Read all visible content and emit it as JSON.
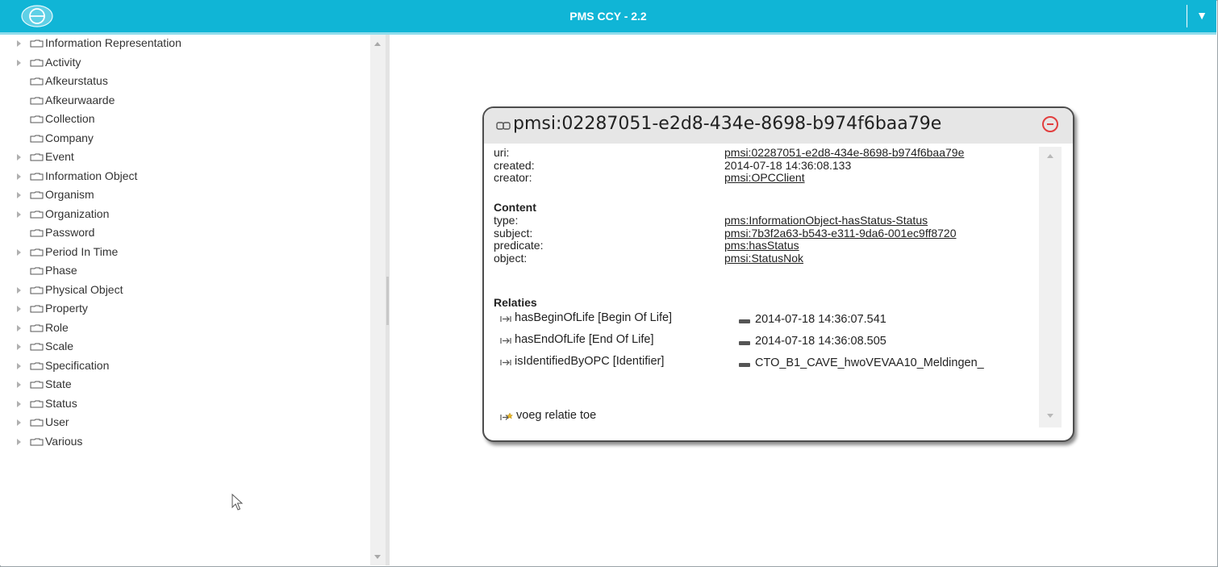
{
  "app": {
    "title": "PMS CCY - 2.2",
    "menu_icon": "triangle-down-icon",
    "accent_color": "#10b5d6"
  },
  "tree": {
    "items": [
      {
        "label": "Information Representation",
        "expandable": true
      },
      {
        "label": "Activity",
        "expandable": true
      },
      {
        "label": "Afkeurstatus",
        "expandable": false
      },
      {
        "label": "Afkeurwaarde",
        "expandable": false
      },
      {
        "label": "Collection",
        "expandable": false
      },
      {
        "label": "Company",
        "expandable": false
      },
      {
        "label": "Event",
        "expandable": true
      },
      {
        "label": "Information Object",
        "expandable": true
      },
      {
        "label": "Organism",
        "expandable": true
      },
      {
        "label": "Organization",
        "expandable": true
      },
      {
        "label": "Password",
        "expandable": false
      },
      {
        "label": "Period In Time",
        "expandable": true
      },
      {
        "label": "Phase",
        "expandable": false
      },
      {
        "label": "Physical Object",
        "expandable": true
      },
      {
        "label": "Property",
        "expandable": true
      },
      {
        "label": "Role",
        "expandable": true
      },
      {
        "label": "Scale",
        "expandable": true
      },
      {
        "label": "Specification",
        "expandable": true
      },
      {
        "label": "State",
        "expandable": true
      },
      {
        "label": "Status",
        "expandable": true
      },
      {
        "label": "User",
        "expandable": true
      },
      {
        "label": "Various",
        "expandable": true
      }
    ]
  },
  "card": {
    "title": "pmsi:02287051-e2d8-434e-8698-b974f6baa79e",
    "close_icon": "minus-circle-icon",
    "meta": [
      {
        "label": "uri:",
        "value": "pmsi:02287051-e2d8-434e-8698-b974f6baa79e",
        "link": true
      },
      {
        "label": "created:",
        "value": "2014-07-18 14:36:08.133",
        "link": false
      },
      {
        "label": "creator:",
        "value": "pmsi:OPCClient",
        "link": true
      }
    ],
    "content_heading": "Content",
    "content": [
      {
        "label": "type:",
        "value": "pms:InformationObject-hasStatus-Status"
      },
      {
        "label": "subject:",
        "value": "pmsi:7b3f2a63-b543-e311-9da6-001ec9ff8720"
      },
      {
        "label": "predicate:",
        "value": "pms:hasStatus"
      },
      {
        "label": "object:",
        "value": "pmsi:StatusNok"
      }
    ],
    "relations_heading": "Relaties",
    "relations": [
      {
        "name": "hasBeginOfLife [Begin Of Life]",
        "target": "2014-07-18 14:36:07.541"
      },
      {
        "name": "hasEndOfLife [End Of Life]",
        "target": "2014-07-18 14:36:08.505"
      },
      {
        "name": "isIdentifiedByOPC [Identifier]",
        "target": "CTO_B1_CAVE_hwoVEVAA10_Meldingen_"
      }
    ],
    "add_relation_label": "voeg relatie toe"
  }
}
